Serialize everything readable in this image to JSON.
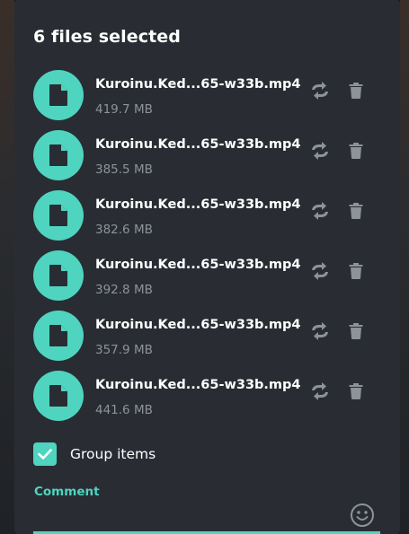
{
  "dialog": {
    "title": "6 files selected",
    "files": [
      {
        "name": "Kuroinu.Ked...65-w33b.mp4",
        "size": "419.7 MB"
      },
      {
        "name": "Kuroinu.Ked...65-w33b.mp4",
        "size": "385.5 MB"
      },
      {
        "name": "Kuroinu.Ked...65-w33b.mp4",
        "size": "382.6 MB"
      },
      {
        "name": "Kuroinu.Ked...65-w33b.mp4",
        "size": "392.8 MB"
      },
      {
        "name": "Kuroinu.Ked...65-w33b.mp4",
        "size": "357.9 MB"
      },
      {
        "name": "Kuroinu.Ked...65-w33b.mp4",
        "size": "441.6 MB"
      }
    ],
    "group_items": {
      "label": "Group items",
      "checked": true
    },
    "comment": {
      "label": "Comment",
      "value": ""
    },
    "icons": {
      "file": "file-icon",
      "replace": "replace-icon",
      "delete": "trash-icon",
      "checkbox": "checkmark-icon",
      "emoji": "smiley-icon"
    },
    "colors": {
      "accent": "#4fd4c0",
      "background": "#292d33",
      "text": "#ffffff",
      "secondary_text": "#8d9399",
      "icon": "#8d9399"
    }
  }
}
